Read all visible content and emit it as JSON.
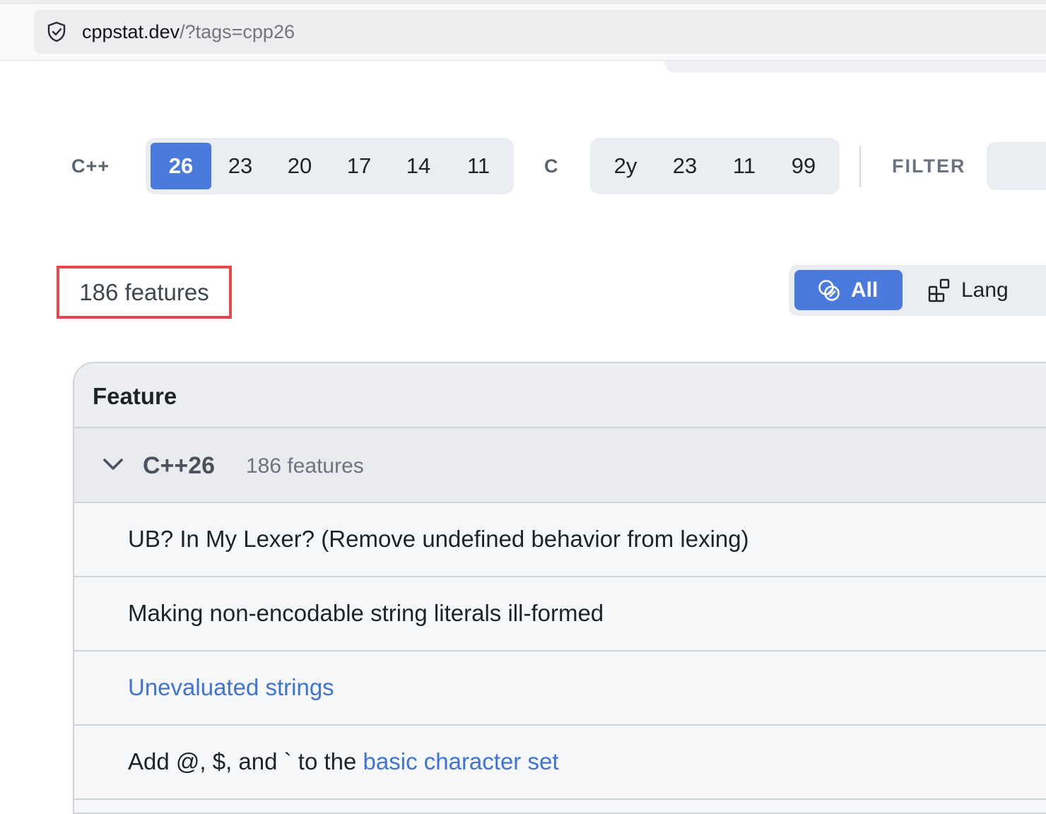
{
  "browser": {
    "url_host": "cppstat.dev",
    "url_path": "/?tags=cpp26"
  },
  "versions": {
    "cpp_label": "C++",
    "cpp": [
      {
        "label": "26",
        "active": true
      },
      {
        "label": "23",
        "active": false
      },
      {
        "label": "20",
        "active": false
      },
      {
        "label": "17",
        "active": false
      },
      {
        "label": "14",
        "active": false
      },
      {
        "label": "11",
        "active": false
      }
    ],
    "c_label": "C",
    "c": [
      {
        "label": "2y",
        "active": false
      },
      {
        "label": "23",
        "active": false
      },
      {
        "label": "11",
        "active": false
      },
      {
        "label": "99",
        "active": false
      }
    ],
    "filter_label": "FILTER"
  },
  "summary": {
    "count": "186 features"
  },
  "view_toggle": {
    "all": "All",
    "lang": "Lang",
    "accent": "#4a7adb"
  },
  "table": {
    "header_feature": "Feature",
    "group": {
      "name": "C++26",
      "count": "186 features"
    },
    "rows": [
      {
        "text": "UB? In My Lexer? (Remove undefined behavior from lexing)"
      },
      {
        "text": "Making non-encodable string literals ill-formed"
      },
      {
        "link": "Unevaluated strings"
      },
      {
        "prefix": "Add @, $, and ` to the ",
        "link": "basic character set"
      }
    ]
  }
}
